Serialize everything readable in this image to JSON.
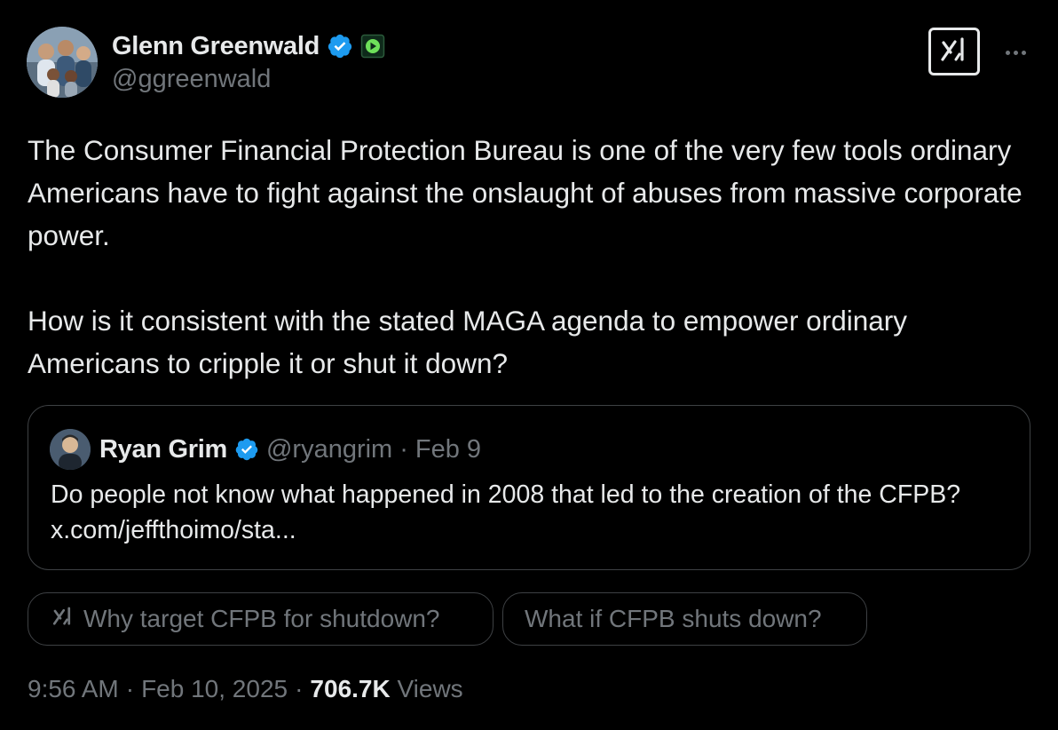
{
  "author": {
    "name": "Glenn Greenwald",
    "handle": "@ggreenwald"
  },
  "tweet": {
    "paragraph_1": "The Consumer Financial Protection Bureau is one of the very few tools ordinary Americans have to fight against the onslaught of abuses from massive corporate power.",
    "paragraph_2": "How is it consistent with the stated MAGA agenda to empower ordinary Americans to cripple it or shut it down?"
  },
  "quote": {
    "name": "Ryan Grim",
    "handle": "@ryangrim",
    "separator": "·",
    "date": "Feb 9",
    "text": "Do people not know what happened in 2008 that led to the creation of the CFPB? x.com/jeffthoimo/sta..."
  },
  "grok_prompts": [
    {
      "label": "Why target CFPB for shutdown?"
    },
    {
      "label": "What if CFPB shuts down?"
    }
  ],
  "meta": {
    "time": "9:56 AM",
    "sep1": "·",
    "date": "Feb 10, 2025",
    "sep2": "·",
    "views_count": "706.7K",
    "views_label": "Views"
  },
  "colors": {
    "background": "#000000",
    "text": "#e7e9ea",
    "muted": "#71767b",
    "border": "#3e4144",
    "verified_blue": "#1d9bf0",
    "affiliate_green": "#1f7a4a"
  },
  "icons": {
    "verified": "verified-badge-icon",
    "affiliate": "rumble-play-icon",
    "grok": "grok-icon",
    "more": "more-dots-icon"
  }
}
